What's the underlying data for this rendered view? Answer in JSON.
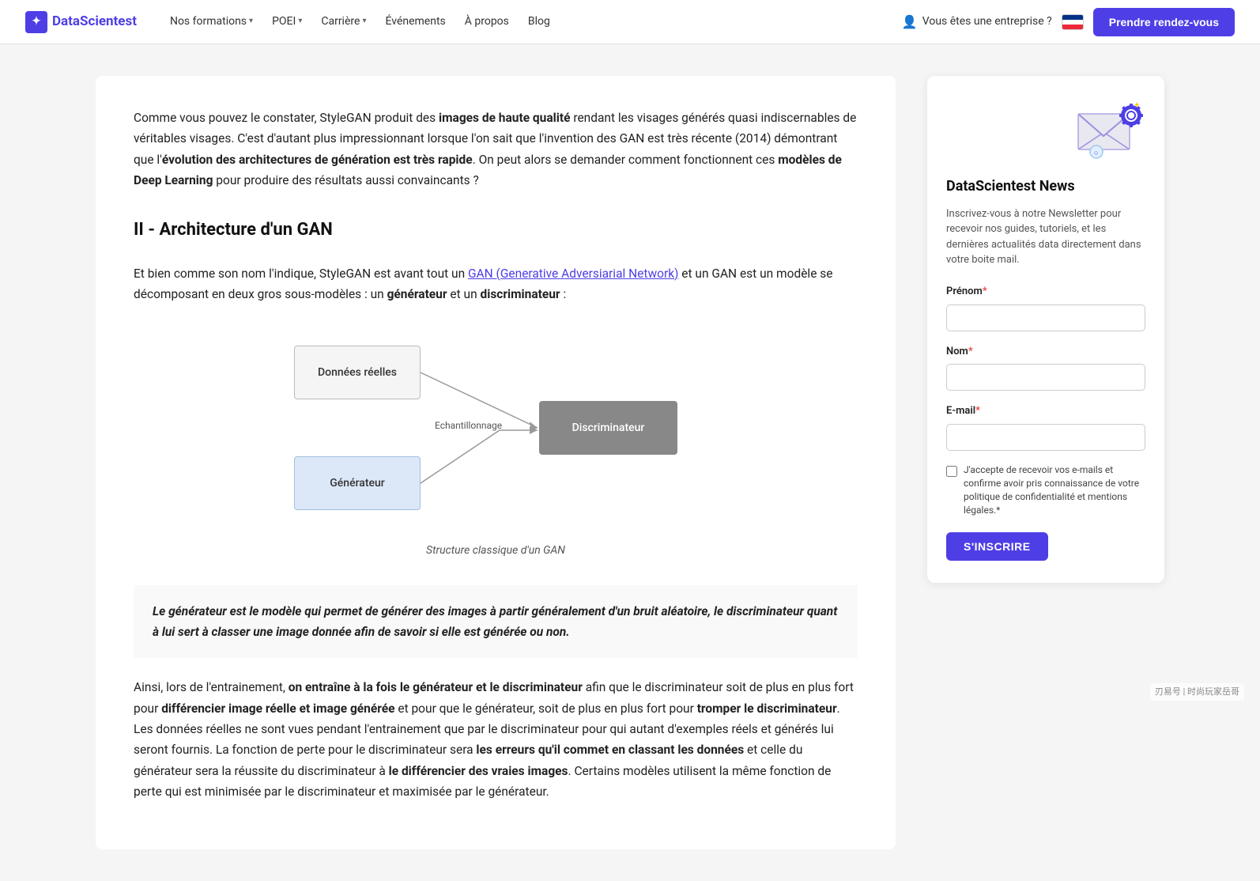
{
  "nav": {
    "logo_text": "DataScientest",
    "links": [
      {
        "label": "Nos formations",
        "has_dropdown": true
      },
      {
        "label": "POEI",
        "has_dropdown": true
      },
      {
        "label": "Carrière",
        "has_dropdown": true
      },
      {
        "label": "Événements",
        "has_dropdown": false
      },
      {
        "label": "À propos",
        "has_dropdown": false
      },
      {
        "label": "Blog",
        "has_dropdown": false
      }
    ],
    "enterprise_label": "Vous êtes une entreprise ?",
    "cta_label": "Prendre rendez-vous"
  },
  "main": {
    "intro": {
      "text_start": "Comme vous pouvez le constater, StyleGAN produit des ",
      "bold1": "images de haute qualité",
      "text2": " rendant les visages générés quasi indiscernables de véritables visages. C'est d'autant plus impressionnant lorsque l'on sait que l'invention des GAN est très récente (2014) démontrant que l'",
      "bold2": "évolution des architectures de génération est très rapide",
      "text3": ". On peut alors se demander comment fonctionnent ces ",
      "bold3": "modèles de Deep Learning",
      "text4": " pour produire des résultats aussi convaincants ?"
    },
    "section_title": "II - Architecture d'un GAN",
    "section_paragraph": {
      "text1": "Et bien comme son nom l'indique, StyleGAN est avant tout un ",
      "link_text": "GAN (Generative Adversiarial Network)",
      "text2": " et un GAN est un modèle se décomposant en deux gros sous-modèles : un ",
      "bold1": "générateur",
      "text3": " et un ",
      "bold2": "discriminateur",
      "text4": " :"
    },
    "diagram": {
      "box_donnees": "Données réelles",
      "box_generateur": "Générateur",
      "box_discriminateur": "Discriminateur",
      "label_echantillonnage": "Echantillonnage",
      "caption": "Structure classique d'un GAN"
    },
    "quote": "Le générateur est le modèle qui permet de générer des images à partir généralement d'un bruit aléatoire, le discriminateur quant à lui sert à classer une image donnée afin de savoir si elle est générée ou non.",
    "body1": {
      "text1": "Ainsi, lors de l'entrainement, ",
      "bold1": "on entraîne à la fois le générateur et le discriminateur",
      "text2": " afin que le discriminateur soit de plus en plus fort pour ",
      "bold2": "différencier image réelle et image générée",
      "text3": " et pour que le générateur, soit de plus en plus fort pour ",
      "bold3": "tromper le discriminateur",
      "text4": ". Les données réelles ne sont vues pendant l'entrainement que par le discriminateur pour qui autant d'exemples réels et générés lui seront fournis. La fonction de perte pour le discriminateur sera ",
      "bold4": "les erreurs qu'il commet en classant les données",
      "text5": " et celle du générateur sera la réussite du discriminateur à ",
      "bold5": "le différencier des vraies images",
      "text6": ". Certains modèles utilisent la même fonction de perte qui est minimisée par le discriminateur et maximisée par le générateur."
    }
  },
  "sidebar": {
    "title": "DataScientest News",
    "description": "Inscrivez-vous à notre Newsletter pour recevoir nos guides, tutoriels, et les dernières actualités data directement dans votre boite mail.",
    "form": {
      "prenom_label": "Prénom",
      "prenom_required": "*",
      "nom_label": "Nom",
      "nom_required": "*",
      "email_label": "E-mail",
      "email_required": "*",
      "checkbox_label": "J'accepte de recevoir vos e-mails et confirme avoir pris connaissance de votre politique de confidentialité et mentions légales.",
      "checkbox_required": "*",
      "submit_label": "S'INSCRIRE"
    }
  },
  "watermark": "刃易号 | 时尚玩家岳哥"
}
